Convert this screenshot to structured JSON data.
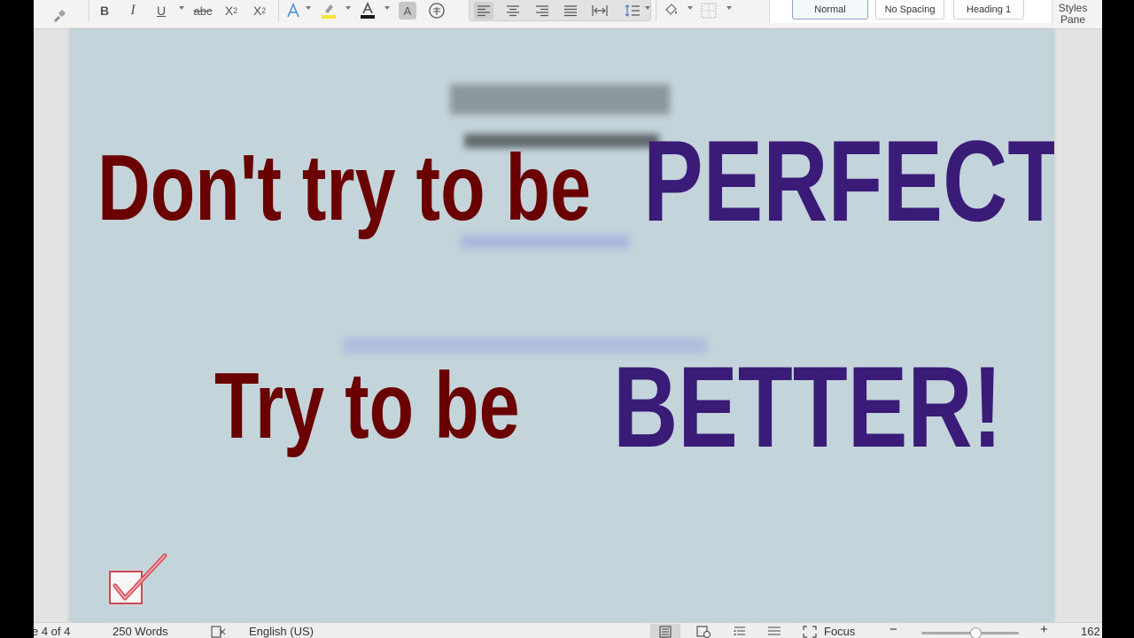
{
  "ribbon": {
    "format_painter_icon": "paintbrush-icon",
    "bold": "B",
    "italic": "I",
    "underline": "U",
    "strikethrough": "abc",
    "subscript": "X",
    "subscript_mark": "2",
    "superscript": "X",
    "superscript_mark": "2",
    "highlight_color": "#f5e33a",
    "font_color": "#1a1a1a",
    "char_shading": "A",
    "styles": {
      "normal": "Normal",
      "no_spacing": "No Spacing",
      "heading1": "Heading 1"
    },
    "styles_pane_line1": "Styles",
    "styles_pane_line2": "Pane"
  },
  "document": {
    "headline_line1_part1": "Don't try  to be",
    "headline_line1_part2": "PERFECT",
    "headline_line2_part1": "Try to be",
    "headline_line2_part2": "BETTER!",
    "colors": {
      "maroon": "#6a0000",
      "purple": "#3a1c78",
      "page_background": "#c3d4db"
    }
  },
  "status_bar": {
    "page_info": "e 4 of 4",
    "word_count": "250 Words",
    "language": "English (US)",
    "focus": "Focus",
    "zoom_out": "−",
    "zoom_in": "+",
    "zoom_value": "162"
  }
}
